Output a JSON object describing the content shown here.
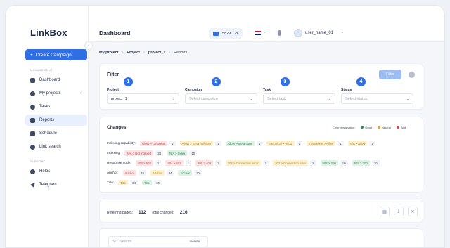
{
  "app": {
    "logo": "LinkBox"
  },
  "sidebar": {
    "create_label": "Create Campaign",
    "management_label": "MANAGEMENT",
    "support_label": "SUPPORT",
    "items": [
      {
        "label": "Dashboard",
        "icon": "dashboard-icon"
      },
      {
        "label": "My projects",
        "icon": "folder-icon"
      },
      {
        "label": "Tasks",
        "icon": "tasks-icon"
      },
      {
        "label": "Reports",
        "icon": "reports-icon"
      },
      {
        "label": "Schedule",
        "icon": "calendar-icon"
      },
      {
        "label": "Link search",
        "icon": "search-icon"
      }
    ],
    "support_items": [
      {
        "label": "Helps",
        "icon": "help-icon"
      },
      {
        "label": "Telegram",
        "icon": "telegram-icon"
      }
    ]
  },
  "header": {
    "title": "Dashboard",
    "balance": "5829.1 cr",
    "username": "user_name_01"
  },
  "breadcrumb": [
    "My project",
    "Project",
    "project_1",
    "Reports"
  ],
  "filter": {
    "title": "Filter",
    "button": "Filter",
    "fields": [
      {
        "label": "Project",
        "value": "project_1",
        "badge": "1"
      },
      {
        "label": "Campaign",
        "placeholder": "Select campaign",
        "badge": "2"
      },
      {
        "label": "Task",
        "placeholder": "Select task",
        "badge": "3"
      },
      {
        "label": "Status",
        "placeholder": "Select status",
        "badge": "4"
      }
    ]
  },
  "changes": {
    "title": "Changes",
    "legend_label": "Color designation:",
    "legend": [
      {
        "label": "Good",
        "color": "#2f8a55"
      },
      {
        "label": "Neutral",
        "color": "#e0a526"
      },
      {
        "label": "Bad",
        "color": "#d64545"
      }
    ],
    "rows": [
      {
        "label": "Indexing capability:",
        "items": [
          {
            "text": "Allow > canonical",
            "tone": "bad",
            "count": "1"
          },
          {
            "text": "Allow > meta nofollow",
            "tone": "neutral",
            "count": "1"
          },
          {
            "text": "Allow > meta none",
            "tone": "good",
            "count": "1"
          },
          {
            "text": "canonical > Allow",
            "tone": "neutral",
            "count": "1"
          },
          {
            "text": "meta none > Allow",
            "tone": "neutral",
            "count": "1"
          },
          {
            "text": "N/A > Allow",
            "tone": "neutral",
            "count": "1"
          }
        ]
      },
      {
        "label": "Indexing:",
        "items": [
          {
            "text": "N/A > Not indexed",
            "tone": "bad",
            "count": "34"
          },
          {
            "text": "N/A > Index",
            "tone": "good",
            "count": "10"
          }
        ]
      },
      {
        "label": "Response code:",
        "items": [
          {
            "text": "403 > 503",
            "tone": "bad",
            "count": "1"
          },
          {
            "text": "404 > 503",
            "tone": "bad",
            "count": "1"
          },
          {
            "text": "200 > 403",
            "tone": "bad",
            "count": "2"
          },
          {
            "text": "302 > Connection error",
            "tone": "neutral",
            "count": "2"
          },
          {
            "text": "302 > Connection error",
            "tone": "neutral",
            "count": "2"
          },
          {
            "text": "503 > 200",
            "tone": "good",
            "count": "10"
          },
          {
            "text": "503 > 200",
            "tone": "good",
            "count": "10"
          }
        ]
      },
      {
        "label": "Anchor:",
        "items": [
          {
            "text": "Anchor",
            "tone": "bad",
            "count": "34"
          },
          {
            "text": "Anchor",
            "tone": "neutral",
            "count": "34"
          },
          {
            "text": "Anchor",
            "tone": "good",
            "count": "10"
          }
        ]
      },
      {
        "label": "Title:",
        "items": [
          {
            "text": "Title",
            "tone": "neutral",
            "count": "34"
          },
          {
            "text": "Title",
            "tone": "good",
            "count": "10"
          }
        ]
      }
    ]
  },
  "stats": {
    "referring_label": "Referring pages:",
    "referring_value": "112",
    "total_label": "Total changes:",
    "total_value": "216"
  },
  "search": {
    "placeholder": "Search",
    "include": "Include"
  }
}
